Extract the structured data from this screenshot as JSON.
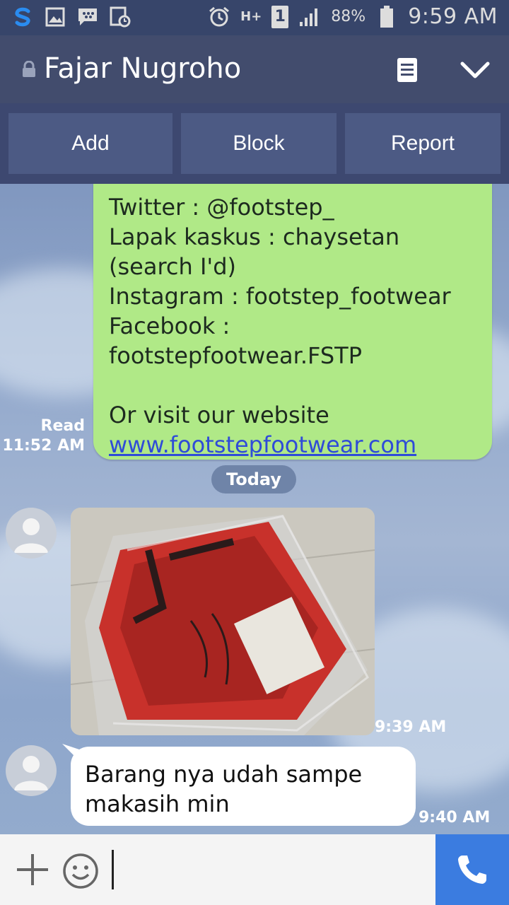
{
  "status_bar": {
    "battery_percent": "88%",
    "time": "9:59 AM",
    "sim_slot": "1",
    "network": "H+",
    "icons": [
      "s-logo-icon",
      "gallery-icon",
      "bbm-icon",
      "calendar-icon",
      "alarm-icon",
      "data-arrows-icon",
      "sim-icon",
      "signal-icon",
      "battery-icon"
    ]
  },
  "header": {
    "contact_name": "Fajar Nugroho",
    "icons": [
      "lock-icon",
      "note-icon",
      "chevron-down-icon"
    ]
  },
  "actions": {
    "add_label": "Add",
    "block_label": "Block",
    "report_label": "Report"
  },
  "chat": {
    "sent_message": {
      "lines": [
        "Twitter : @footstep_",
        "Lapak kaskus : chaysetan",
        "(search I'd)",
        "Instagram : footstep_footwear",
        "Facebook :",
        "footstepfootwear.FSTP",
        "",
        "Or visit our website"
      ],
      "link": "www.footstepfootwear.com",
      "read_label": "Read",
      "time": "11:52 AM"
    },
    "date_divider": "Today",
    "received": [
      {
        "type": "image",
        "time": "9:39 AM"
      },
      {
        "type": "text",
        "lines": [
          "Barang nya udah sampe",
          "makasih min"
        ],
        "time": "9:40 AM"
      }
    ]
  },
  "input_bar": {
    "icons": [
      "plus-icon",
      "emoji-icon",
      "phone-icon"
    ],
    "value": ""
  },
  "colors": {
    "status_bar": "#37456a",
    "header": "#424c6d",
    "action_button": "#4c5a84",
    "sent_bubble": "#b0e987",
    "link": "#2f4cd8",
    "call_button": "#3b7ce0"
  }
}
